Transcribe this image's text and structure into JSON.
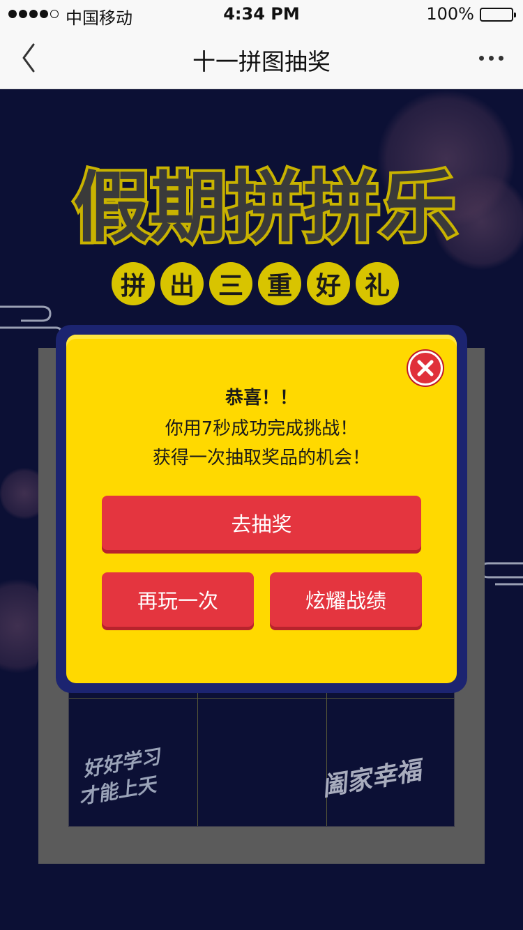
{
  "status_bar": {
    "carrier": "中国移动",
    "time": "4:34 PM",
    "battery": "100%",
    "battery_level": 1.0,
    "signal_bars": 4
  },
  "nav": {
    "title": "十一拼图抽奖",
    "back_icon": "chevron-left-icon",
    "more_icon": "more-dots-icon"
  },
  "banner": {
    "headline": "假期拼拼乐",
    "sub_chars": [
      "拼",
      "出",
      "三",
      "重",
      "好",
      "礼"
    ]
  },
  "puzzle": {
    "deco_left_line1": "好好学习",
    "deco_left_line2": "才能上天",
    "deco_right": "阖家幸福"
  },
  "modal": {
    "title": "恭喜！！",
    "line1": "你用7秒成功完成挑战！",
    "line2": "获得一次抽取奖品的机会！",
    "close_icon": "close-icon",
    "primary_button": "去抽奖",
    "replay_button": "再玩一次",
    "share_button": "炫耀战绩"
  },
  "colors": {
    "background": "#0c1035",
    "modal_yellow": "#ffd900",
    "modal_border": "#1c2470",
    "button_red": "#e4353f",
    "headline_gold": "#d8c400"
  }
}
